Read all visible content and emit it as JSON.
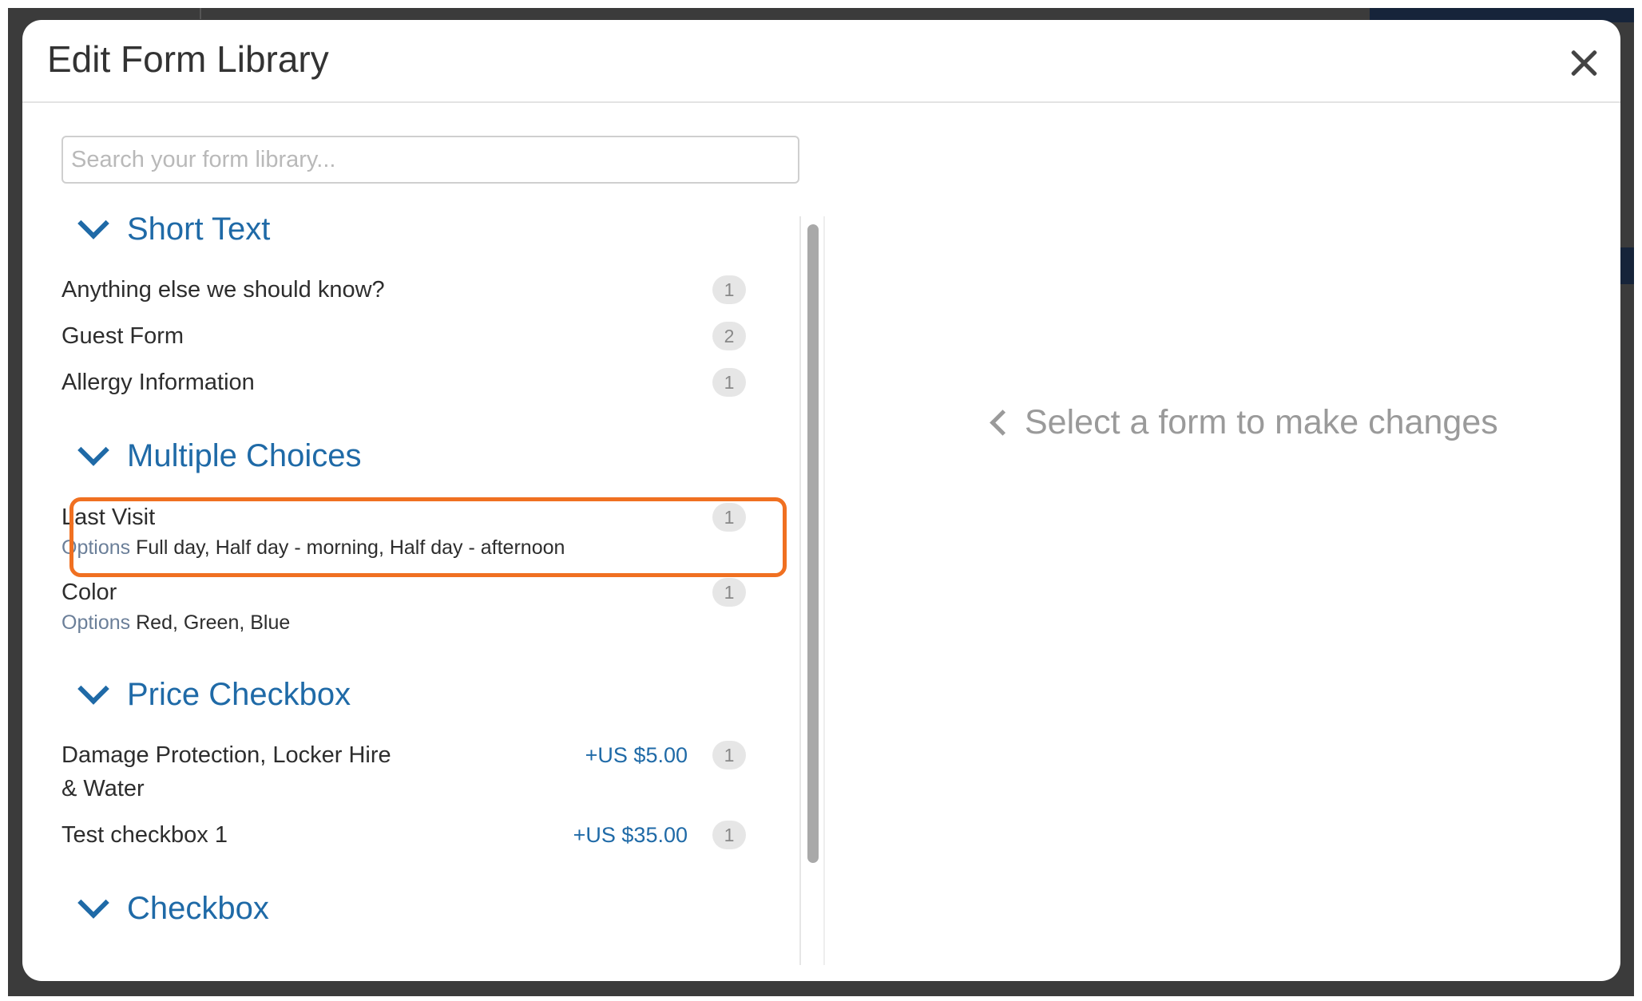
{
  "modal": {
    "title": "Edit Form Library",
    "close_label": "×"
  },
  "search": {
    "placeholder": "Search your form library...",
    "value": ""
  },
  "sections": {
    "short_text": {
      "title": "Short Text",
      "items": [
        {
          "label": "Anything else we should know?",
          "count": "1"
        },
        {
          "label": "Guest Form",
          "count": "2"
        },
        {
          "label": "Allergy Information",
          "count": "1"
        }
      ]
    },
    "multiple_choices": {
      "title": "Multiple Choices",
      "items": [
        {
          "label": "Last Visit",
          "options_key": "Options",
          "options": "Full day, Half day - morning, Half day - afternoon",
          "count": "1"
        },
        {
          "label": "Color",
          "options_key": "Options",
          "options": "Red, Green, Blue",
          "count": "1"
        }
      ]
    },
    "price_checkbox": {
      "title": "Price Checkbox",
      "items": [
        {
          "label": "Damage Protection, Locker Hire & Water",
          "price": "+US $5.00",
          "count": "1"
        },
        {
          "label": "Test checkbox 1",
          "price": "+US $35.00",
          "count": "1"
        }
      ]
    },
    "checkbox": {
      "title": "Checkbox"
    }
  },
  "detail": {
    "empty_message": "Select a form to make changes"
  },
  "accent_color": "#1f6aa7",
  "highlight_color": "#f07021",
  "icons": {
    "close": "close-icon",
    "chevron": "chevron-down-icon",
    "back": "chevron-left-icon"
  }
}
